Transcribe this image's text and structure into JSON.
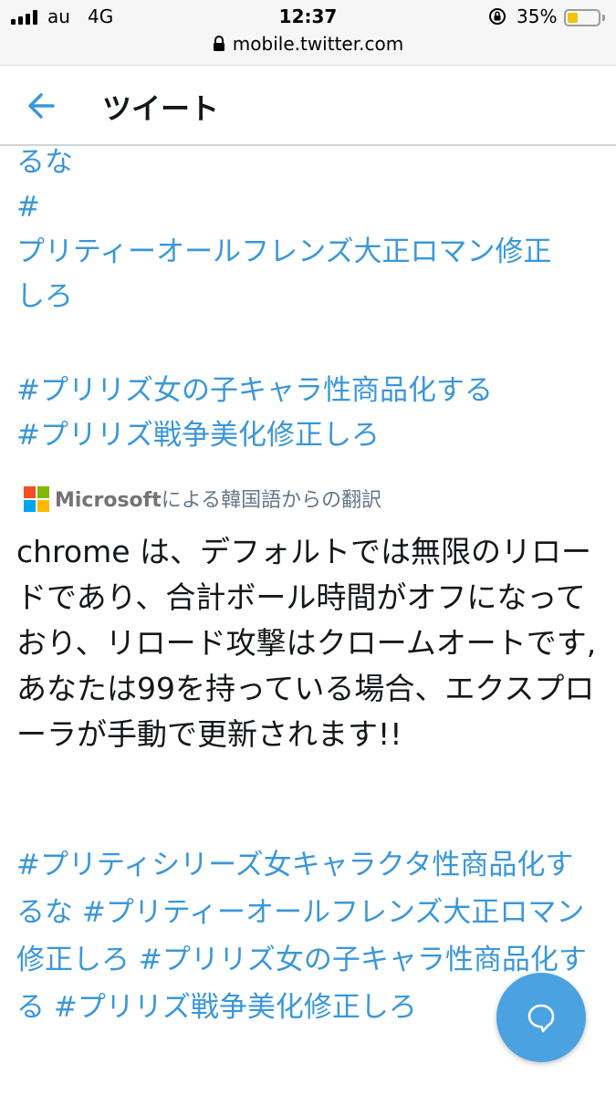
{
  "status_bar": {
    "carrier": "au",
    "network": "4G",
    "time": "12:37",
    "battery_percent": "35%",
    "battery_level": 0.35,
    "battery_color": "#f4c20d",
    "signal_bars": 4
  },
  "url_bar": {
    "url": "mobile.twitter.com"
  },
  "header": {
    "title": "ツイート",
    "back_icon": "arrow-left-icon"
  },
  "tweet": {
    "top_lines": [
      "るな",
      "#",
      "プリティーオールフレンズ大正ロマン修正",
      "しろ"
    ],
    "top_hashtags": [
      "#プリリズ女の子キャラ性商品化する",
      "#プリリズ戦争美化修正しろ"
    ],
    "translation": {
      "provider": "Microsoft",
      "note": "による韓国語からの翻訳"
    },
    "translated_text": "chrome は、デフォルトでは無限のリロードであり、合計ボール時間がオフになっており、リロード攻撃はクロームオートです, あなたは99を持っている場合、エクスプローラが手動で更新されます!!",
    "bottom_hashtags": [
      "#プリティシリーズ女キャラクタ性商品化するな",
      "#プリティーオールフレンズ大正ロマン修正しろ",
      "#プリリズ女の子キャラ性商品化する",
      "#プリリズ戦争美化修正しろ"
    ]
  },
  "fab": {
    "icon": "chat-bubble-icon",
    "color": "#4aa2e0"
  },
  "colors": {
    "link": "#3a97d8",
    "text": "#14171a",
    "muted": "#657786"
  }
}
